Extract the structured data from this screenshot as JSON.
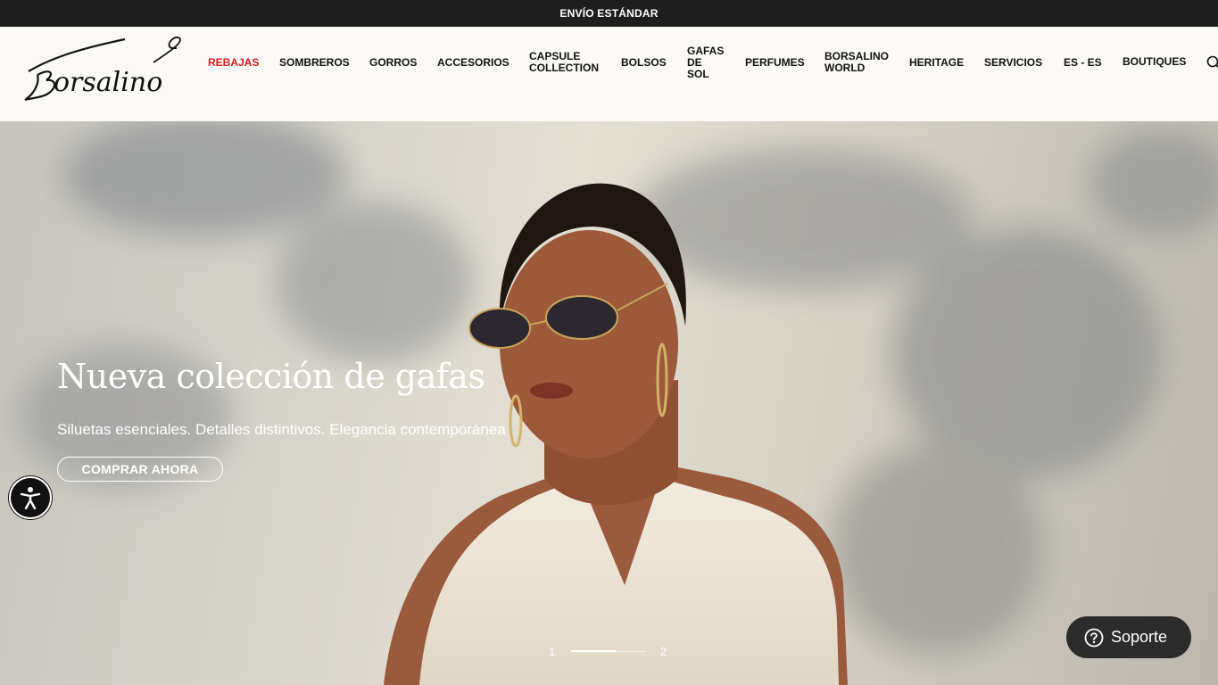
{
  "topbar": {
    "text": "ENVÍO ESTÁNDAR"
  },
  "header": {
    "logo_text": "Borsalino",
    "nav": [
      {
        "label": "REBAJAS",
        "sale": true
      },
      {
        "label": "SOMBREROS"
      },
      {
        "label": "GORROS"
      },
      {
        "label": "ACCESORIOS"
      },
      {
        "label": "CAPSULE\nCOLLECTION"
      },
      {
        "label": "BOLSOS"
      },
      {
        "label": "GAFAS\nDE\nSOL"
      },
      {
        "label": "PERFUMES"
      },
      {
        "label": "BORSALINO\nWORLD"
      },
      {
        "label": "HERITAGE"
      },
      {
        "label": "SERVICIOS"
      },
      {
        "label": "ES - ES"
      },
      {
        "label": "BOUTIQUES"
      }
    ],
    "search_icon": "search-icon"
  },
  "hero": {
    "title": "Nueva colección de gafas",
    "subtitle": "Siluetas esenciales. Detalles distintivos. Elegancia contemporánea",
    "cta": "COMPRAR AHORA",
    "slide_first": "1",
    "slide_last": "2"
  },
  "accessibility": {
    "icon": "accessibility-icon"
  },
  "support": {
    "label": "Soporte",
    "icon": "help-icon"
  },
  "colors": {
    "topbar": "#1e1e1e",
    "sale": "#d0201f",
    "support_bg": "#2b2b2b"
  }
}
